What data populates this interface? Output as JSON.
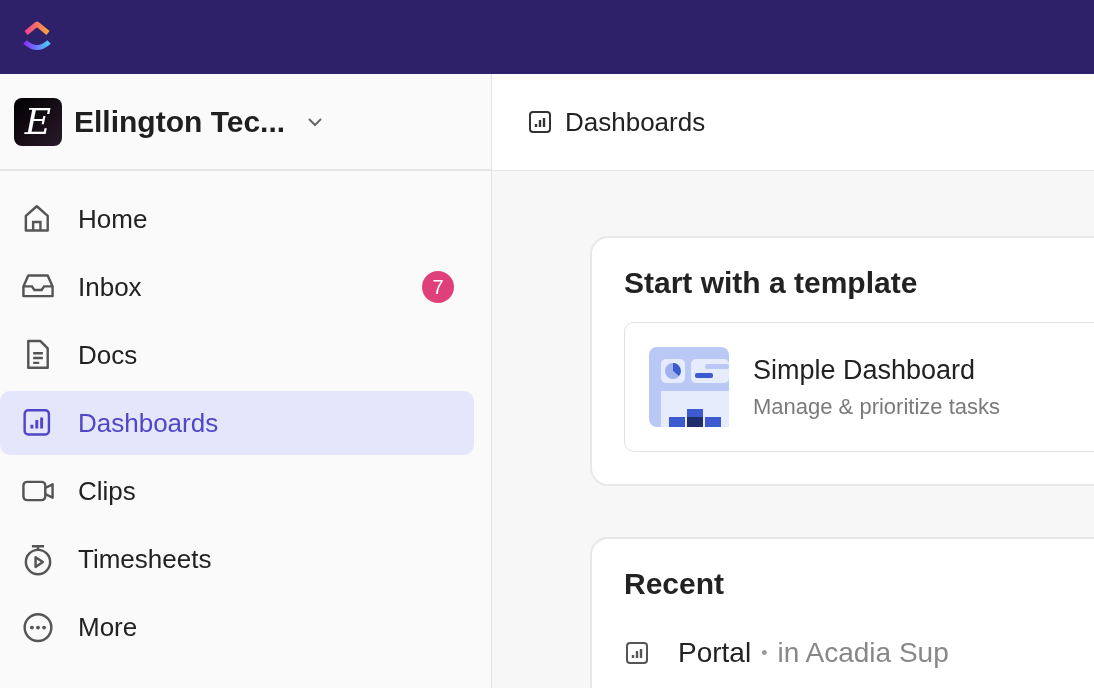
{
  "workspace": {
    "name": "Ellington Tec...",
    "initial": "E"
  },
  "sidebar": {
    "items": [
      {
        "label": "Home",
        "kind": "home",
        "selected": false
      },
      {
        "label": "Inbox",
        "kind": "inbox",
        "selected": false,
        "badge": "7"
      },
      {
        "label": "Docs",
        "kind": "docs",
        "selected": false
      },
      {
        "label": "Dashboards",
        "kind": "dashboards",
        "selected": true
      },
      {
        "label": "Clips",
        "kind": "clips",
        "selected": false
      },
      {
        "label": "Timesheets",
        "kind": "timesheets",
        "selected": false
      },
      {
        "label": "More",
        "kind": "more",
        "selected": false
      }
    ]
  },
  "header": {
    "title": "Dashboards"
  },
  "templates": {
    "title": "Start with a template",
    "items": [
      {
        "title": "Simple Dashboard",
        "subtitle": "Manage & prioritize tasks"
      }
    ]
  },
  "recent": {
    "title": "Recent",
    "items": [
      {
        "name": "Portal",
        "separator": "•",
        "location": "in Acadia Sup"
      }
    ]
  }
}
